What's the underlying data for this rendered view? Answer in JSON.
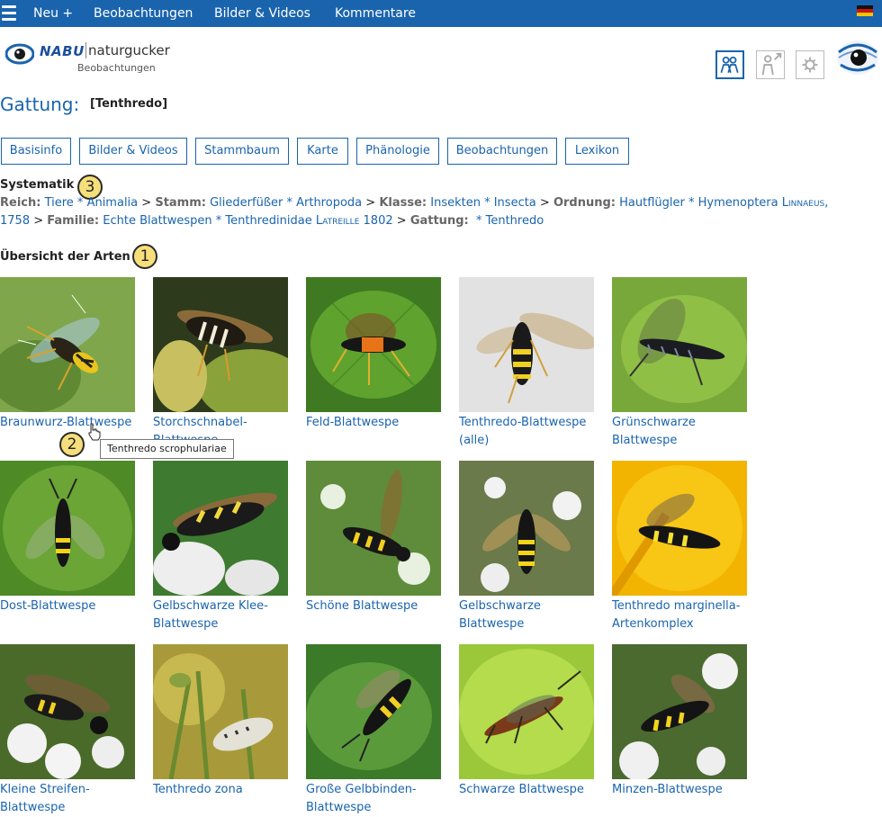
{
  "nav": {
    "items": [
      "Neu +",
      "Beobachtungen",
      "Bilder & Videos",
      "Kommentare"
    ]
  },
  "logo": {
    "brand": "NABU",
    "name": "naturgucker",
    "sub": "Beobachtungen"
  },
  "header": {
    "title": "Gattung:",
    "genus": "[Tenthredo]"
  },
  "tabs": [
    "Basisinfo",
    "Bilder & Videos",
    "Stammbaum",
    "Karte",
    "Phänologie",
    "Beobachtungen",
    "Lexikon"
  ],
  "systematik": {
    "heading": "Systematik",
    "reich_k": "Reich:",
    "reich_v": "Tiere * Animalia",
    "stamm_k": "Stamm:",
    "stamm_v": "Gliederfüßer * Arthropoda",
    "klasse_k": "Klasse:",
    "klasse_v": "Insekten * Insecta",
    "ordnung_k": "Ordnung:",
    "ordnung_v": "Hautflügler * Hymenoptera",
    "ordnung_auth": "Linnaeus",
    "ordnung_year": "1758",
    "familie_k": "Familie:",
    "familie_v": "Echte Blattwespen * Tenthredinidae",
    "familie_auth": "Latreille",
    "familie_year": "1802",
    "gattung_k": "Gattung:",
    "gattung_v": "* Tenthredo",
    "sep": ">"
  },
  "overview_heading": "Übersicht der Arten",
  "badges": [
    "1",
    "2",
    "3"
  ],
  "species": [
    {
      "line1": "Braunwurz-Blattwespe",
      "line2": ""
    },
    {
      "line1": "Storchschnabel-",
      "line2": "Blattwespe"
    },
    {
      "line1": "Feld-Blattwespe",
      "line2": ""
    },
    {
      "line1": "Tenthredo-Blattwespe",
      "line2": "(alle)"
    },
    {
      "line1": "Grünschwarze",
      "line2": "Blattwespe"
    },
    {
      "line1": "Dost-Blattwespe",
      "line2": ""
    },
    {
      "line1": "Gelbschwarze Klee-",
      "line2": "Blattwespe"
    },
    {
      "line1": "Schöne Blattwespe",
      "line2": ""
    },
    {
      "line1": "Gelbschwarze",
      "line2": "Blattwespe"
    },
    {
      "line1": "Tenthredo marginella-",
      "line2": "Artenkomplex"
    },
    {
      "line1": "Kleine Streifen-",
      "line2": "Blattwespe"
    },
    {
      "line1": "Tenthredo zona",
      "line2": ""
    },
    {
      "line1": "Große Gelbbinden-",
      "line2": "Blattwespe"
    },
    {
      "line1": "Schwarze Blattwespe",
      "line2": ""
    },
    {
      "line1": "Minzen-Blattwespe",
      "line2": ""
    }
  ],
  "tooltip": "Tenthredo scrophulariae",
  "colors": {
    "link": "#1a64ad",
    "topbar": "#1a64ad",
    "badge": "#f6df7a"
  },
  "icons": [
    "menu-icon",
    "german-flag-icon",
    "people-icon",
    "person-share-icon",
    "gear-icon",
    "naturgucker-eye-icon",
    "mouse-pointer-icon"
  ]
}
